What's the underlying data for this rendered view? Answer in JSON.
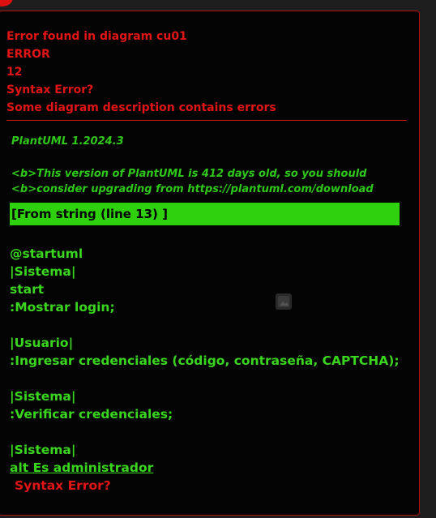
{
  "error": {
    "title": "Error found in diagram cu01",
    "type": "ERROR",
    "line_number": "12",
    "message": "Syntax Error?",
    "description": "Some diagram description contains errors"
  },
  "plantuml": {
    "version": "PlantUML 1.2024.3",
    "upgrade_line1": "<b>This version of PlantUML is 412 days old, so you should",
    "upgrade_line2": "<b>consider upgrading from https://plantuml.com/download"
  },
  "source_header": "[From string (line 13) ]",
  "code_lines": [
    "",
    "@startuml",
    "|Sistema|",
    "start",
    ":Mostrar login;",
    "",
    "|Usuario|",
    ":Ingresar credenciales (código, contraseña, CAPTCHA);",
    "",
    "|Sistema|",
    ":Verificar credenciales;",
    "",
    "|Sistema|",
    "alt Es administrador",
    "Syntax Error?"
  ],
  "colors": {
    "error_red": "#e01515",
    "code_green": "#3ad61f",
    "highlight_green": "#2fd10e",
    "panel_bg": "#040404"
  },
  "icons": {
    "corner": "error-indicator-icon",
    "image": "image-placeholder-icon"
  }
}
